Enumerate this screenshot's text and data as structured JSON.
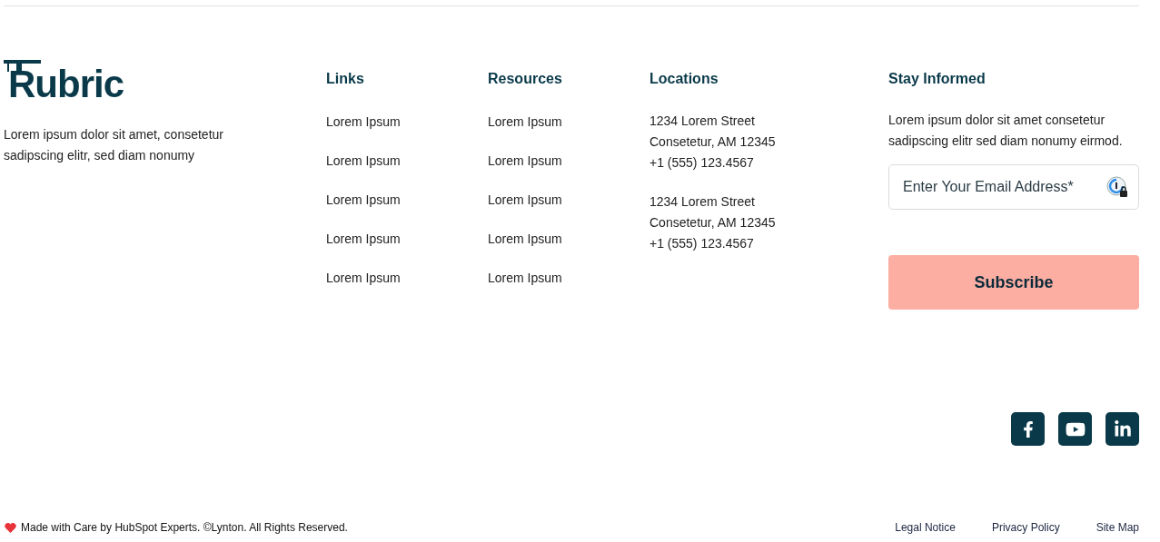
{
  "brand": {
    "name": "Rubric",
    "tagline": "Lorem ipsum dolor sit amet, consetetur sadipscing elitr, sed diam nonumy"
  },
  "columns": [
    {
      "heading": "Links",
      "items": [
        "Lorem Ipsum",
        "Lorem Ipsum",
        "Lorem Ipsum",
        "Lorem Ipsum",
        "Lorem Ipsum"
      ]
    },
    {
      "heading": "Resources",
      "items": [
        "Lorem Ipsum",
        "Lorem Ipsum",
        "Lorem Ipsum",
        "Lorem Ipsum",
        "Lorem Ipsum"
      ]
    }
  ],
  "locations": {
    "heading": "Locations",
    "addresses": [
      {
        "street": "1234 Lorem Street",
        "city": "Consetetur, AM 12345",
        "phone": "+1 (555) 123.4567"
      },
      {
        "street": "1234 Lorem Street",
        "city": "Consetetur, AM 12345",
        "phone": "+1 (555) 123.4567"
      }
    ]
  },
  "newsletter": {
    "heading": "Stay Informed",
    "text": "Lorem ipsum dolor sit amet consetetur sadipscing elitr sed diam nonumy eirmod.",
    "email": {
      "placeholder": "Enter Your Email Address*"
    },
    "button": "Subscribe"
  },
  "social": [
    {
      "kind": "facebook"
    },
    {
      "kind": "youtube"
    },
    {
      "kind": "linkedin"
    }
  ],
  "bottom": {
    "credit": "Made with Care by HubSpot Experts. ©Lynton. All Rights Reserved.",
    "links": [
      "Legal Notice",
      "Privacy Policy",
      "Site Map"
    ]
  }
}
